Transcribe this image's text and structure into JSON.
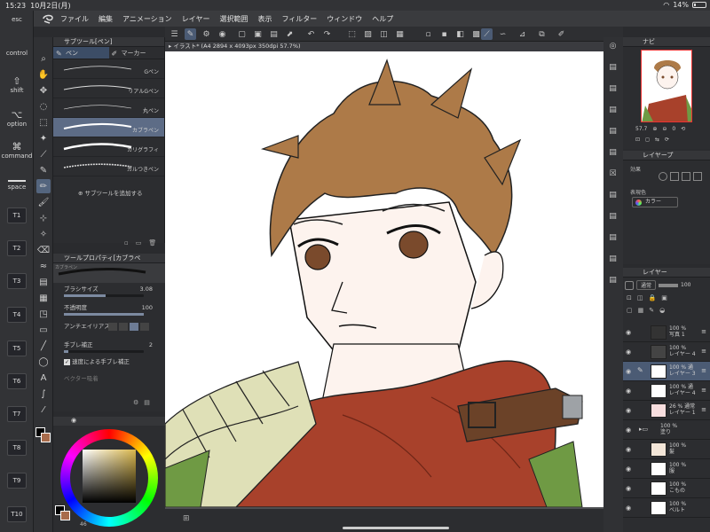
{
  "status_bar": {
    "time": "15:23",
    "date": "10月2日(月)",
    "battery": "14%"
  },
  "menu": {
    "items": [
      "ファイル",
      "編集",
      "アニメーション",
      "レイヤー",
      "選択範囲",
      "表示",
      "フィルター",
      "ウィンドウ",
      "ヘルプ"
    ]
  },
  "modifier_bar": {
    "keys": [
      {
        "glyph": "",
        "label": "esc"
      },
      {
        "glyph": "",
        "label": "control"
      },
      {
        "glyph": "⇧",
        "label": "shift"
      },
      {
        "glyph": "⌥",
        "label": "option"
      },
      {
        "glyph": "⌘",
        "label": "command"
      },
      {
        "glyph": "",
        "label": "space"
      }
    ],
    "tbuttons": [
      "T1",
      "T2",
      "T3",
      "T4",
      "T5",
      "T6",
      "T7",
      "T8",
      "T9",
      "T10"
    ]
  },
  "subtool": {
    "title": "サブツール[ペン]",
    "tabs": [
      "ペン",
      "マーカー"
    ],
    "brushes": [
      "Gペン",
      "リアルGペン",
      "丸ペン",
      "カブラペン",
      "カリグラフィ",
      "ガルつきペン"
    ],
    "selected_index": 3,
    "add_label": "サブツールを追加する"
  },
  "tool_property": {
    "title": "ツールプロパティ[カブラペ",
    "brush_name": "カブラペン",
    "size_label": "ブラシサイズ",
    "size_value": "3.08",
    "opacity_label": "不透明度",
    "opacity_value": "100",
    "aa_label": "アンチエイリアス",
    "stab_label": "手ブレ補正",
    "stab_value": "2",
    "speed_label": "速度による手ブレ補正",
    "vector_label": "ベクター吸着"
  },
  "color": {
    "main": "#000000",
    "sub": "#a86b4b",
    "bottom_value": "46"
  },
  "canvas": {
    "title": "イラスト* (A4 2894 x 4093px 350dpi 57.7%)"
  },
  "navigator": {
    "title": "ナビ",
    "zoom": "57.7",
    "angle": "0"
  },
  "layer_property": {
    "title": "レイヤープ",
    "effect_label": "効果",
    "expression_label": "表現色",
    "expression_value": "カラー"
  },
  "layers": {
    "title": "レイヤー",
    "blend": "通常",
    "opacity": "100",
    "rows": [
      {
        "pct": "100 %",
        "name": "写真 1"
      },
      {
        "pct": "100 %",
        "name": "レイヤー 4"
      },
      {
        "pct": "100 % 通",
        "name": "レイヤー 3"
      },
      {
        "pct": "100 % 通",
        "name": "レイヤー 4"
      },
      {
        "pct": "26 % 通常",
        "name": "レイヤー 1"
      },
      {
        "pct": "100 %",
        "name": "塗り"
      },
      {
        "pct": "100 %",
        "name": "髪"
      },
      {
        "pct": "100 %",
        "name": "服"
      },
      {
        "pct": "100 %",
        "name": "こもの"
      },
      {
        "pct": "100 %",
        "name": "ベルト"
      }
    ]
  }
}
